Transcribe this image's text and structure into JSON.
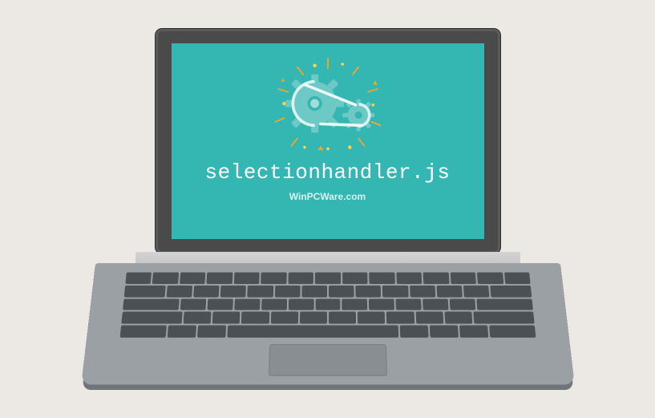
{
  "screen": {
    "filename": "selectionhandler.js",
    "branding": "WinPCWare.com"
  },
  "colors": {
    "screen_bg": "#34b6b2",
    "gear_fill": "#6cc9c5",
    "accent_orange": "#f5a623",
    "accent_yellow": "#f8d44c",
    "text_white": "#ffffff"
  }
}
